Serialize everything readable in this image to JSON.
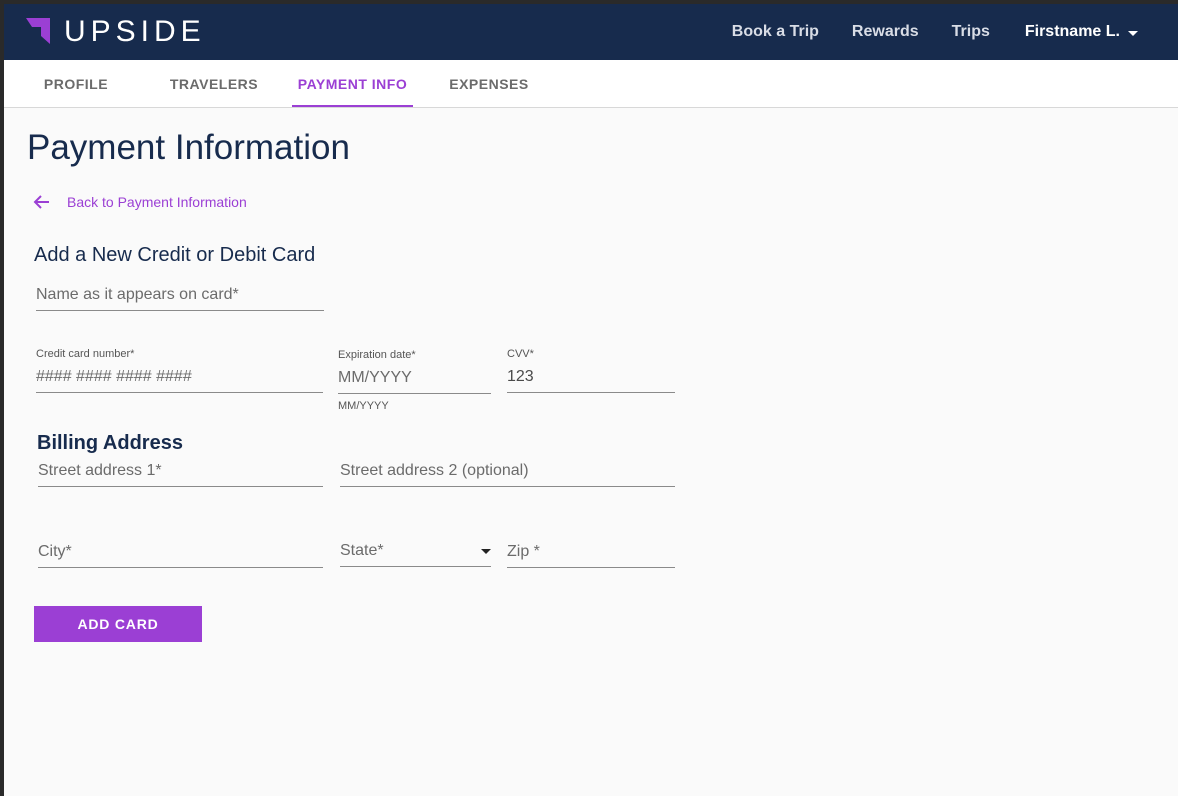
{
  "header": {
    "brand": "UPSIDE",
    "nav": [
      "Book a Trip",
      "Rewards",
      "Trips"
    ],
    "user": "Firstname L."
  },
  "tabs": [
    {
      "label": "PROFILE",
      "active": false
    },
    {
      "label": "TRAVELERS",
      "active": false
    },
    {
      "label": "PAYMENT INFO",
      "active": true
    },
    {
      "label": "EXPENSES",
      "active": false
    }
  ],
  "page": {
    "title": "Payment Information",
    "back_link": "Back to Payment Information",
    "card_section_title": "Add a New Credit or Debit Card",
    "billing_title": "Billing Address"
  },
  "form": {
    "name_on_card": {
      "placeholder": "Name as it appears on card*"
    },
    "card_number": {
      "label": "Credit card number*",
      "placeholder": "#### #### #### ####"
    },
    "expiration": {
      "label": "Expiration date*",
      "placeholder": "MM/YYYY",
      "helper": "MM/YYYY"
    },
    "cvv": {
      "label": "CVV*",
      "value": "123"
    },
    "street1": {
      "placeholder": "Street address 1*"
    },
    "street2": {
      "placeholder": "Street address 2 (optional)"
    },
    "city": {
      "placeholder": "City*"
    },
    "state": {
      "placeholder": "State*"
    },
    "zip": {
      "placeholder": "Zip *"
    },
    "submit": "ADD CARD"
  },
  "colors": {
    "header_bg": "#172b4d",
    "accent": "#9b3fd4",
    "title": "#172b4d"
  }
}
